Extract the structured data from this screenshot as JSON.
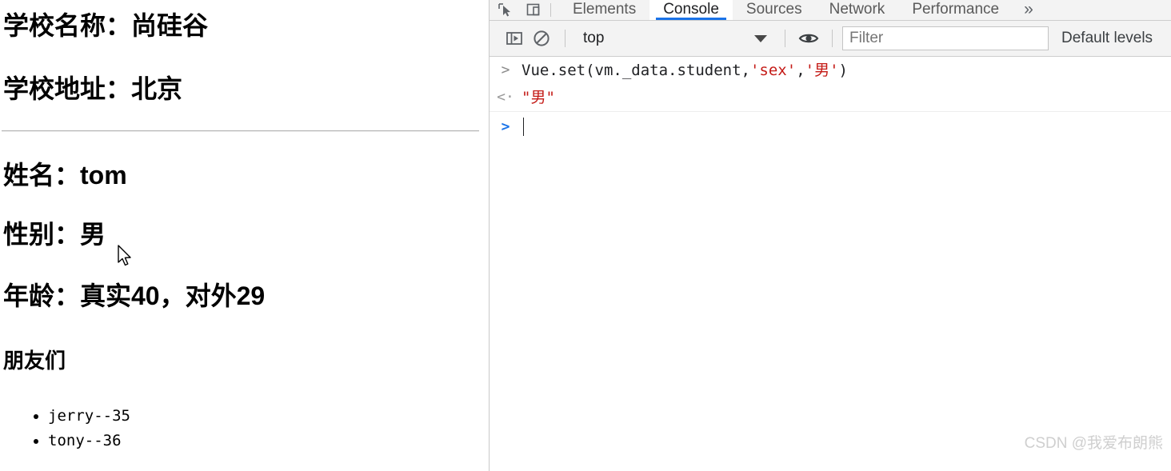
{
  "page": {
    "school_name_line": "学校名称：尚硅谷",
    "school_address_line": "学校地址：北京",
    "name_line": "姓名：tom",
    "sex_line": "性别：男",
    "age_line": "年龄：真实40，对外29",
    "friends_heading": "朋友们",
    "friends": [
      "jerry--35",
      "tony--36"
    ]
  },
  "devtools": {
    "icons": {
      "inspect": "inspect-element-icon",
      "device": "device-toolbar-icon",
      "sidebar": "console-sidebar-icon",
      "clear": "clear-console-icon",
      "eye": "live-expression-eye-icon"
    },
    "tabs": [
      {
        "label": "Elements",
        "active": false
      },
      {
        "label": "Console",
        "active": true
      },
      {
        "label": "Sources",
        "active": false
      },
      {
        "label": "Network",
        "active": false
      },
      {
        "label": "Performance",
        "active": false
      }
    ],
    "more_tabs_label": "»",
    "toolbar": {
      "context_value": "top",
      "filter_placeholder": "Filter",
      "filter_value": "",
      "levels_label": "Default levels"
    },
    "console": {
      "input_gutter": ">",
      "output_gutter": "<·",
      "prompt_gutter": ">",
      "command_prefix": "Vue.set(vm._data.student,",
      "command_arg1": "'sex'",
      "command_comma": ",",
      "command_arg2": "'男'",
      "command_suffix": ")",
      "result_value": "\"男\""
    }
  },
  "watermark": "CSDN @我爱布朗熊",
  "colors": {
    "accent_blue": "#1a73e8",
    "string_red": "#c41a16",
    "toolbar_gray": "#f3f3f3"
  }
}
